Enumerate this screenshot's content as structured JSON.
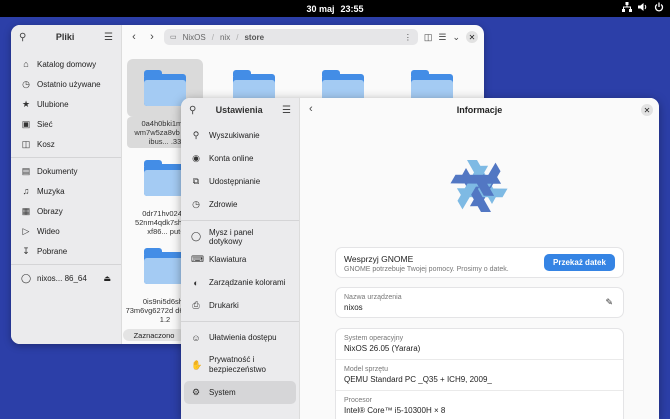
{
  "topbar": {
    "date": "30 maj",
    "time": "23:55",
    "icons": [
      "network-icon",
      "volume-icon",
      "power-icon"
    ]
  },
  "files": {
    "title": "Pliki",
    "sidebar": [
      {
        "icon": "home-icon",
        "label": "Katalog domowy"
      },
      {
        "icon": "clock-icon",
        "label": "Ostatnio używane"
      },
      {
        "icon": "star-icon",
        "label": "Ulubione"
      },
      {
        "icon": "network-icon",
        "label": "Sieć"
      },
      {
        "icon": "trash-icon",
        "label": "Kosz"
      },
      {
        "icon": "document-icon",
        "label": "Dokumenty"
      },
      {
        "icon": "music-icon",
        "label": "Muzyka"
      },
      {
        "icon": "pictures-icon",
        "label": "Obrazy"
      },
      {
        "icon": "video-icon",
        "label": "Wideo"
      },
      {
        "icon": "download-icon",
        "label": "Pobrane"
      },
      {
        "icon": "drive-icon",
        "label": "nixos... 86_64"
      }
    ],
    "path": [
      "NixOS",
      "nix",
      "store"
    ],
    "items": [
      {
        "name": "0a4h0bki1mfq wm7w5za8vb hwj-ibus... .33",
        "selected": true
      },
      {
        "name": ""
      },
      {
        "name": ""
      },
      {
        "name": ""
      },
      {
        "name": "0dr71hv024in 52nm4qdk7sh h0-xf86... put-"
      },
      {
        "name": "0is9ni5d6sh7 73m6vg6272d d6-libao-1.2"
      }
    ],
    "selection_text": "Zaznaczono"
  },
  "settings": {
    "title": "Ustawienia",
    "page_title": "Informacje",
    "sidebar": [
      {
        "icon": "search-icon",
        "label": "Wyszukiwanie"
      },
      {
        "icon": "online-accounts-icon",
        "label": "Konta online"
      },
      {
        "icon": "share-icon",
        "label": "Udostępnianie"
      },
      {
        "icon": "health-icon",
        "label": "Zdrowie"
      },
      {
        "icon": "mouse-icon",
        "label": "Mysz i panel dotykowy"
      },
      {
        "icon": "keyboard-icon",
        "label": "Klawiatura"
      },
      {
        "icon": "color-icon",
        "label": "Zarządzanie kolorami"
      },
      {
        "icon": "printer-icon",
        "label": "Drukarki"
      },
      {
        "icon": "accessibility-icon",
        "label": "Ułatwienia dostępu"
      },
      {
        "icon": "privacy-icon",
        "label": "Prywatność i bezpieczeństwo"
      },
      {
        "icon": "system-icon",
        "label": "System",
        "active": true
      }
    ],
    "gnome": {
      "title": "Wesprzyj GNOME",
      "subtitle": "GNOME potrzebuje Twojej pomocy. Prosimy o datek.",
      "button": "Przekaż datek"
    },
    "device": {
      "label": "Nazwa urządzenia",
      "value": "nixos"
    },
    "hardware": [
      {
        "label": "System operacyjny",
        "value": "NixOS 26.05 (Yarara)"
      },
      {
        "label": "Model sprzętu",
        "value": "QEMU Standard PC _Q35 + ICH9, 2009_"
      },
      {
        "label": "Procesor",
        "value": "Intel® Core™ i5-10300H × 8"
      }
    ],
    "logo_colors": {
      "dark": "#5277c3",
      "light": "#7ebae4"
    }
  }
}
